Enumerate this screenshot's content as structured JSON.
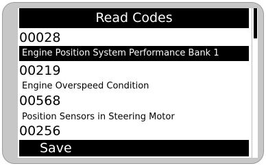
{
  "screen": {
    "title": "Read Codes"
  },
  "codes": [
    {
      "code": "00028",
      "description": "Engine Position System Performance Bank 1",
      "selected": true
    },
    {
      "code": "00219",
      "description": "Engine Overspeed Condition",
      "selected": false
    },
    {
      "code": "00568",
      "description": "Position Sensors in Steering Motor",
      "selected": false
    },
    {
      "code": "00256",
      "description": "",
      "selected": false
    }
  ],
  "actions": {
    "save_label": "Save"
  },
  "scrollbar": {
    "position_fraction": 0.0,
    "visible_fraction": 0.2
  },
  "colors": {
    "bezel": "#c7c7c7",
    "screen_bg": "#ffffff",
    "highlight": "#000000",
    "text": "#000000",
    "highlight_text": "#ffffff"
  }
}
